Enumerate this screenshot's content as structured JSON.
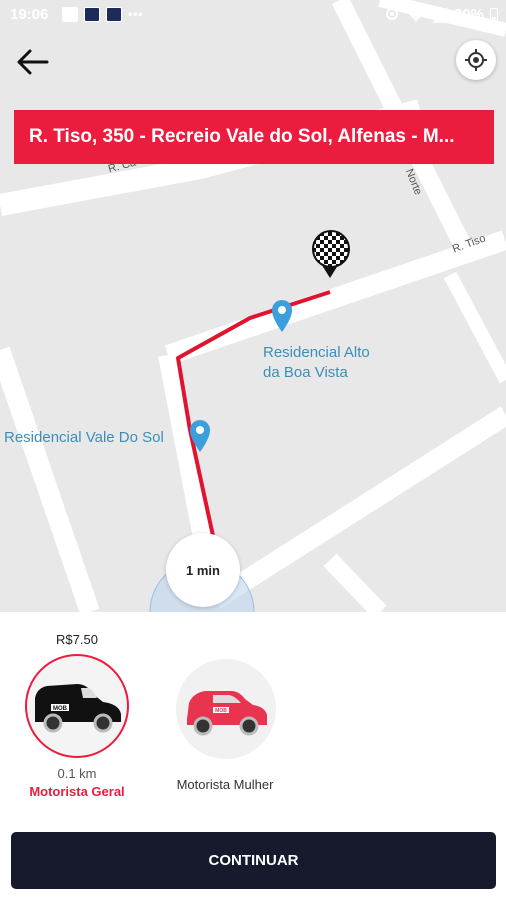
{
  "status_bar": {
    "time": "19:06",
    "battery": "20%"
  },
  "header": {
    "back_icon": "arrow-left-icon",
    "locate_icon": "crosshair-icon",
    "destination_address": "R. Tiso, 350 - Recreio Vale do Sol, Alfenas - M..."
  },
  "map": {
    "streets": {
      "top_left": "R. Ca",
      "right_vertical": "Norte",
      "right_horizontal": "R. Tiso"
    },
    "pois": [
      {
        "line1": "Residencial Alto",
        "line2": "da Boa Vista",
        "icon": "map-pin-icon"
      },
      {
        "line1": "Residencial Vale Do Sol",
        "icon": "map-pin-icon"
      }
    ],
    "destination_icon": "checkered-flag-pin-icon",
    "eta": "1 min",
    "route_color": "#e0142f",
    "poi_color": "#3a9fdc"
  },
  "ride_options": [
    {
      "price": "R$7.50",
      "distance": "0.1 km",
      "name": "Motorista Geral",
      "selected": true,
      "car_color": "#111111",
      "logo": "MOB"
    },
    {
      "name": "Motorista Mulher",
      "selected": false,
      "car_color": "#e8344e",
      "logo": "MOB"
    }
  ],
  "continue_label": "CONTINUAR",
  "colors": {
    "accent": "#ec1c3e",
    "button_bg": "#161a2c"
  }
}
